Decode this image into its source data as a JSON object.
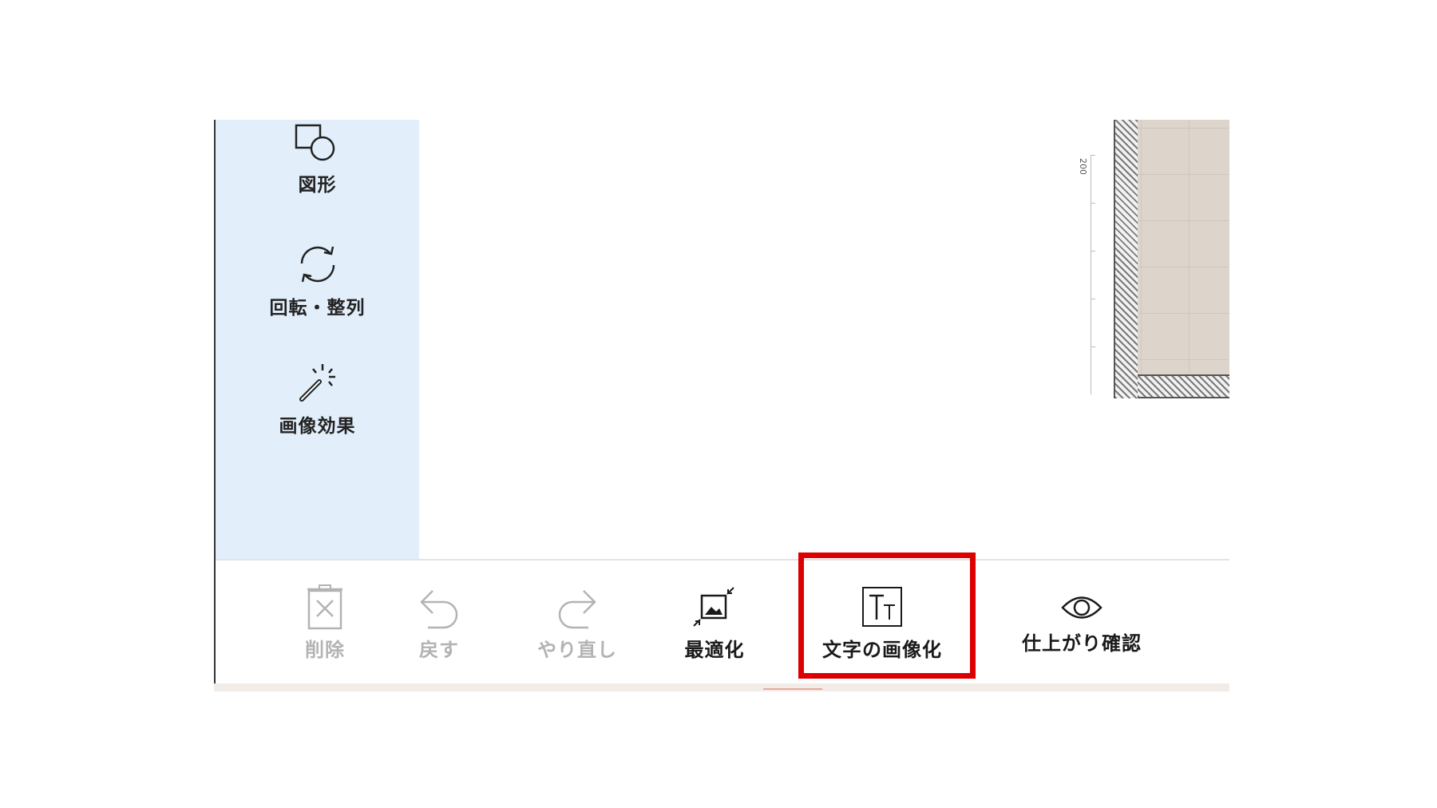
{
  "side_panel": {
    "items": [
      {
        "label": "図形",
        "icon": "shapes-icon"
      },
      {
        "label": "回転・整列",
        "icon": "rotate-icon"
      },
      {
        "label": "画像効果",
        "icon": "magic-wand-icon"
      }
    ]
  },
  "canvas": {
    "ruler_label": "200"
  },
  "toolbar": {
    "delete_label": "削除",
    "undo_label": "戻す",
    "redo_label": "やり直し",
    "optimize_label": "最適化",
    "text_to_image_label": "文字の画像化",
    "preview_label": "仕上がり確認"
  },
  "colors": {
    "side_panel_bg": "#e2eefa",
    "highlight": "#dd0000",
    "disabled_text": "#b3b3b3",
    "floor": "#ddd4cb"
  }
}
